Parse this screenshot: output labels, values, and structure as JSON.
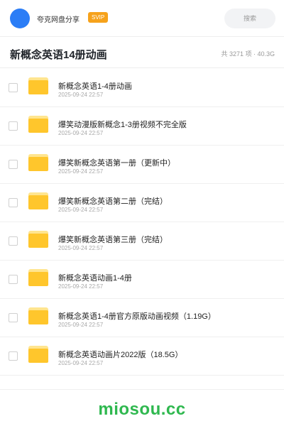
{
  "header": {
    "share_title": "夸克网盘分享",
    "badge": "SVIP",
    "search_placeholder": "搜索"
  },
  "folder": {
    "title": "新概念英语14册动画",
    "meta": "共 3271 项 · 40.3G"
  },
  "files": [
    {
      "name": "新概念英语1-4册动画",
      "date": "2025-09-24 22:57"
    },
    {
      "name": "爆笑动漫版新概念1-3册视频不完全版",
      "date": "2025-09-24 22:57"
    },
    {
      "name": "爆笑新概念英语第一册（更新中）",
      "date": "2025-09-24 22:57"
    },
    {
      "name": "爆笑新概念英语第二册（完结）",
      "date": "2025-09-24 22:57"
    },
    {
      "name": "爆笑新概念英语第三册（完结）",
      "date": "2025-09-24 22:57"
    },
    {
      "name": "新概念英语动画1-4册",
      "date": "2025-09-24 22:57"
    },
    {
      "name": "新概念英语1-4册官方原版动画视频（1.19G）",
      "date": "2025-09-24 22:57"
    },
    {
      "name": "新概念英语动画片2022版（18.5G）",
      "date": "2025-09-24 22:57"
    }
  ],
  "watermark": "miosou.cc",
  "colors": {
    "accent_blue": "#2b7df6",
    "svip_orange": "#f6a21b",
    "folder_yellow": "#ffc62c",
    "watermark_green": "#2fb84f"
  },
  "icons": {
    "avatar": "avatar-circle",
    "file_type": "folder-icon"
  }
}
